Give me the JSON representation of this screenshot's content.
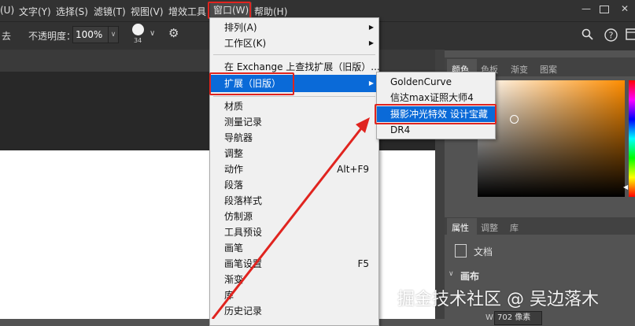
{
  "menubar": {
    "items": [
      {
        "label": "(U)"
      },
      {
        "label": "文字(Y)"
      },
      {
        "label": "选择(S)"
      },
      {
        "label": "滤镜(T)"
      },
      {
        "label": "视图(V)"
      },
      {
        "label": "增效工具"
      },
      {
        "label": "窗口(W)"
      },
      {
        "label": "帮助(H)"
      }
    ],
    "window_controls": [
      "minimize-icon",
      "restore-icon",
      "close-icon"
    ]
  },
  "options_bar": {
    "left_clip": "去",
    "opacity_label": "不透明度：",
    "opacity_value": "100%",
    "brush_size": "34",
    "right_icons": [
      "search-icon",
      "help-icon",
      "workspace-icon"
    ]
  },
  "window_menu": {
    "items": [
      {
        "label": "排列(A)",
        "submenu": true
      },
      {
        "label": "工作区(K)",
        "submenu": true
      },
      {
        "label": "在 Exchange 上查找扩展（旧版）..."
      },
      {
        "label": "扩展（旧版）",
        "submenu": true,
        "highlighted": true
      },
      {
        "label": "材质"
      },
      {
        "label": "测量记录"
      },
      {
        "label": "导航器"
      },
      {
        "label": "调整"
      },
      {
        "label": "动作",
        "shortcut": "Alt+F9"
      },
      {
        "label": "段落"
      },
      {
        "label": "段落样式"
      },
      {
        "label": "仿制源"
      },
      {
        "label": "工具预设"
      },
      {
        "label": "画笔"
      },
      {
        "label": "画笔设置",
        "shortcut": "F5"
      },
      {
        "label": "渐变"
      },
      {
        "label": "库"
      },
      {
        "label": "历史记录"
      }
    ]
  },
  "extensions_submenu": {
    "items": [
      {
        "label": "GoldenCurve"
      },
      {
        "label": "信达max证照大师4"
      },
      {
        "label": "摄影冲光特效 设计宝藏",
        "highlighted": true
      },
      {
        "label": "DR4"
      }
    ]
  },
  "color_panel": {
    "tabs": [
      "颜色",
      "色板",
      "渐变",
      "图案"
    ],
    "active_tab": "颜色",
    "base_hue": "#ff8d00"
  },
  "properties_panel": {
    "tabs": [
      "属性",
      "调整",
      "库"
    ],
    "active_tab": "属性",
    "doc_label": "文档",
    "section_label": "画布",
    "w_label": "W",
    "w_value": "702 像素"
  },
  "watermark": "掘金技术社区 @ 吴边落木",
  "colors": {
    "accent_red": "#e0241f",
    "menu_highlight": "#0a6ad8"
  }
}
